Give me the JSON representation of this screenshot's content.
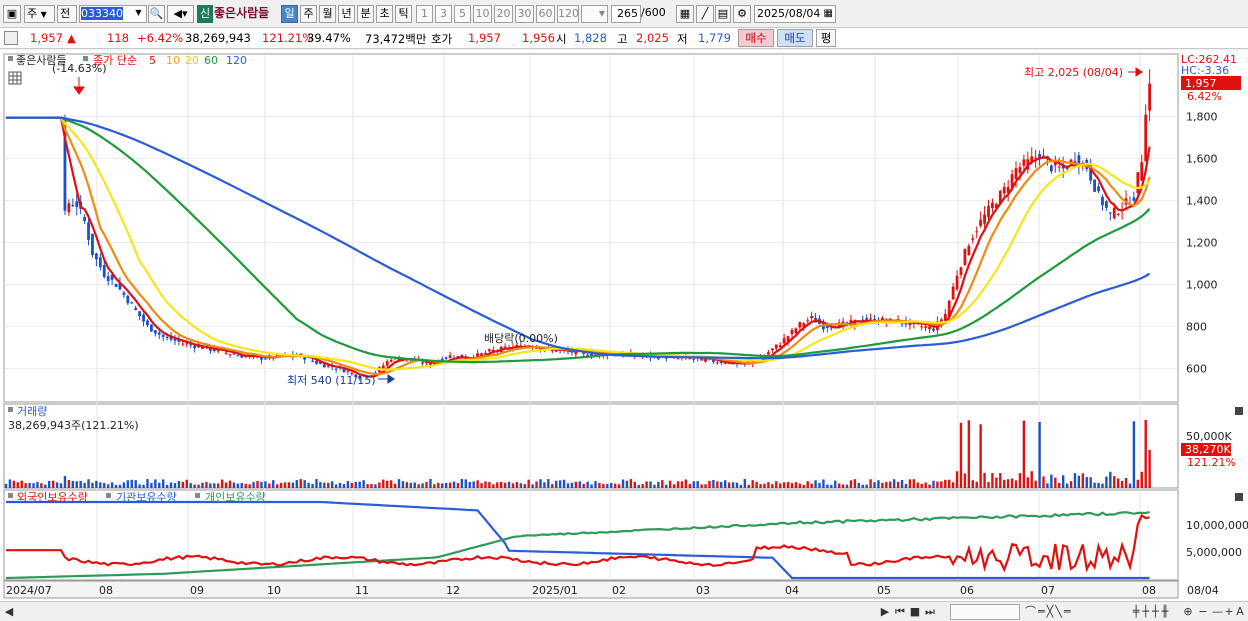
{
  "toolbar": {
    "period_week": "주",
    "prev_label": "전",
    "code": "033340",
    "new_badge": "신",
    "stock_name": "좋은사람들",
    "period_tabs": [
      "일",
      "주",
      "월",
      "년",
      "분",
      "초",
      "틱"
    ],
    "minute_options": [
      "1",
      "3",
      "5",
      "10",
      "20",
      "30",
      "60",
      "120"
    ],
    "count_display": "265",
    "count_total": "/600",
    "date": "2025/08/04"
  },
  "quote": {
    "price": "1,957",
    "change_arrow": "▲",
    "change": "118",
    "change_pct": "+6.42%",
    "volume": "38,269,943",
    "volume_pct": "121.21%",
    "turnover": "39.47%",
    "amount": "73,472백만",
    "bid_label": "호가",
    "ask1": "1,957",
    "bid1": "1,956",
    "open_label": "시",
    "open": "1,828",
    "high_label": "고",
    "high": "2,025",
    "low_label": "저",
    "low": "1,779",
    "buy_label": "매수",
    "sell_label": "매도",
    "eval_label": "평"
  },
  "price_panel": {
    "legend_name": "좋은사람들",
    "legend_ma": "종가 단순",
    "ma_periods": [
      "5",
      "10",
      "20",
      "60",
      "120"
    ],
    "lc_label": "LC:262.41",
    "hc_label": "HC:-3.36",
    "current_price_tag": "1,957",
    "current_pct_tag": "6.42%",
    "high_annotation": "최고 2,025 (08/04)",
    "low_annotation": "최저 540 (11/15)",
    "dividend_annotation": "배당락(0.00%)",
    "drop_annotation": "(-14.63%)",
    "y_ticks": [
      "1,800",
      "1,600",
      "1,400",
      "1,200",
      "1,000",
      "800",
      "600"
    ]
  },
  "volume_panel": {
    "title": "거래량",
    "value_label": "38,269,943주(121.21%)",
    "axis_label": "50,000K",
    "last_tag": "38,270K",
    "last_pct_tag": "121.21%"
  },
  "holdings_panel": {
    "series_labels": [
      "외국인보유수량",
      "기관보유수량",
      "개인보유수량"
    ],
    "y_ticks": [
      "10,000,000",
      "5,000,000"
    ]
  },
  "x_axis": {
    "labels": [
      "2024/07",
      "08",
      "09",
      "10",
      "11",
      "12",
      "2025/01",
      "02",
      "03",
      "04",
      "05",
      "06",
      "07",
      "08"
    ],
    "right_label": "08/04"
  },
  "colors": {
    "up": "#e01010",
    "down": "#1a50c8",
    "ma5": "#e01010",
    "ma10": "#f08a10",
    "ma20": "#f5e61a",
    "ma60": "#1e9a3a",
    "ma120": "#2a5cd8",
    "foreign": "#e01010",
    "institution": "#2a5cd8",
    "individual": "#2e9a5a"
  },
  "chart_data": {
    "type": "candlestick",
    "period": "2024/07 - 2025/08/04",
    "ma_periods": [
      5,
      10,
      20,
      60,
      120
    ],
    "x_labels": [
      "2024/07",
      "08",
      "09",
      "10",
      "11",
      "12",
      "2025/01",
      "02",
      "03",
      "04",
      "05",
      "06",
      "07",
      "08"
    ],
    "price_ticks": [
      600,
      800,
      1000,
      1200,
      1400,
      1600,
      1800
    ],
    "close_path": [
      [
        0,
        1795
      ],
      [
        14,
        1795
      ],
      [
        15,
        1330
      ],
      [
        16,
        1390
      ],
      [
        18,
        1380
      ],
      [
        20,
        1300
      ],
      [
        22,
        1150
      ],
      [
        25,
        1050
      ],
      [
        28,
        1000
      ],
      [
        32,
        900
      ],
      [
        36,
        800
      ],
      [
        40,
        750
      ],
      [
        45,
        720
      ],
      [
        50,
        700
      ],
      [
        55,
        680
      ],
      [
        60,
        660
      ],
      [
        65,
        650
      ],
      [
        70,
        660
      ],
      [
        75,
        660
      ],
      [
        80,
        620
      ],
      [
        85,
        600
      ],
      [
        90,
        560
      ],
      [
        94,
        580
      ],
      [
        98,
        650
      ],
      [
        103,
        640
      ],
      [
        108,
        620
      ],
      [
        113,
        660
      ],
      [
        118,
        650
      ],
      [
        123,
        680
      ],
      [
        128,
        700
      ],
      [
        133,
        710
      ],
      [
        138,
        690
      ],
      [
        143,
        680
      ],
      [
        148,
        670
      ],
      [
        153,
        670
      ],
      [
        158,
        665
      ],
      [
        163,
        660
      ],
      [
        168,
        655
      ],
      [
        173,
        650
      ],
      [
        178,
        640
      ],
      [
        183,
        630
      ],
      [
        188,
        620
      ],
      [
        192,
        650
      ],
      [
        197,
        720
      ],
      [
        202,
        810
      ],
      [
        205,
        840
      ],
      [
        208,
        800
      ],
      [
        213,
        810
      ],
      [
        218,
        830
      ],
      [
        223,
        830
      ],
      [
        228,
        820
      ],
      [
        233,
        800
      ],
      [
        236,
        790
      ],
      [
        239,
        860
      ],
      [
        242,
        1050
      ],
      [
        245,
        1200
      ],
      [
        248,
        1300
      ],
      [
        251,
        1380
      ],
      [
        254,
        1450
      ],
      [
        257,
        1550
      ],
      [
        260,
        1580
      ],
      [
        263,
        1620
      ],
      [
        266,
        1560
      ],
      [
        269,
        1550
      ],
      [
        272,
        1600
      ],
      [
        275,
        1560
      ],
      [
        278,
        1420
      ],
      [
        281,
        1330
      ],
      [
        284,
        1370
      ],
      [
        287,
        1420
      ],
      [
        289,
        1600
      ],
      [
        290,
        1839
      ],
      [
        291,
        1957
      ]
    ],
    "volume_spikes": [
      {
        "date": "2025/06",
        "value": 45000000
      },
      {
        "date": "2025/06",
        "value": 39000000
      },
      {
        "date": "2025/07",
        "value": 42000000
      },
      {
        "date": "2025/08/04",
        "value": 38269943
      }
    ],
    "holdings": [
      {
        "name": "외국인보유수량",
        "start": 5300000,
        "end": 10200000
      },
      {
        "name": "기관보유수량",
        "start": 14500000,
        "end": 0
      },
      {
        "name": "개인보유수량",
        "start": 0,
        "end": 12600000
      }
    ]
  }
}
